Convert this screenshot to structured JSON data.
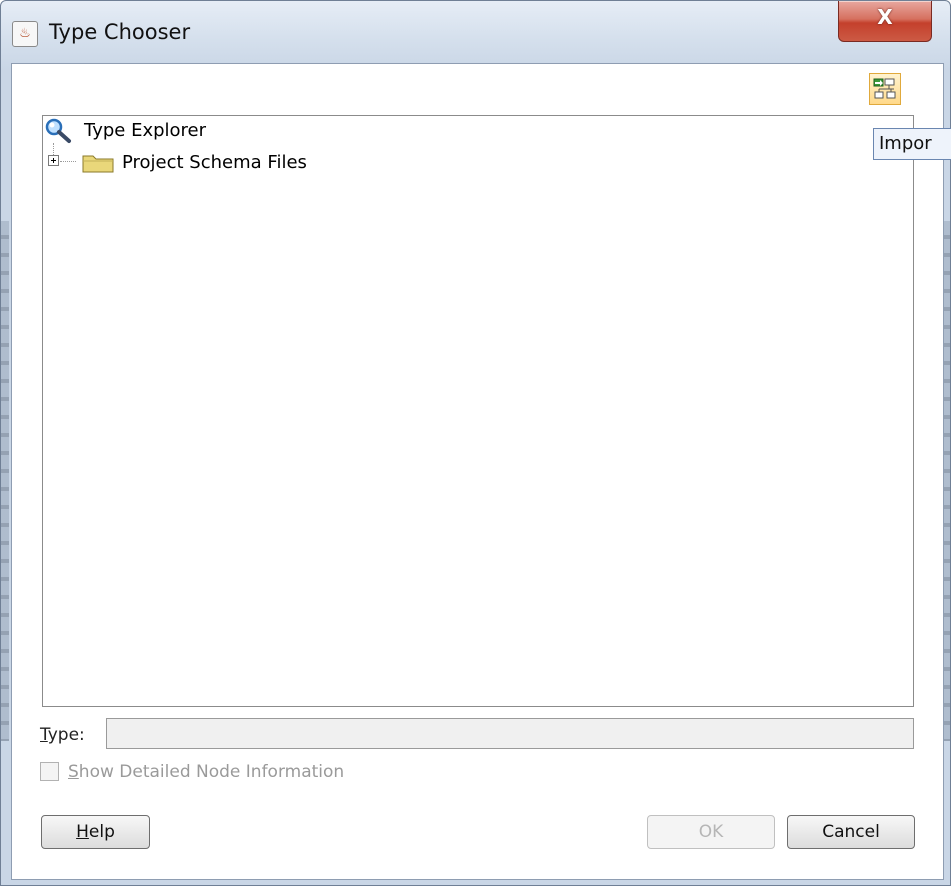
{
  "window": {
    "title": "Type Chooser",
    "close_label": "X"
  },
  "toolbar": {
    "import_tooltip": "Impor"
  },
  "tree": {
    "root_label": "Type Explorer",
    "children": [
      {
        "label": "Project Schema Files"
      }
    ]
  },
  "type_field": {
    "label_mnemonic": "T",
    "label_rest": "ype:",
    "value": ""
  },
  "options": {
    "show_details_mnemonic": "S",
    "show_details_rest": "how Detailed Node Information",
    "show_details_checked": false
  },
  "buttons": {
    "help_mnemonic": "H",
    "help_rest": "elp",
    "ok": "OK",
    "cancel": "Cancel"
  },
  "colors": {
    "titlebar": "#d4dfec",
    "close": "#c4402c",
    "disabled_text": "#9a9a9a",
    "folder": "#e9d77a"
  }
}
